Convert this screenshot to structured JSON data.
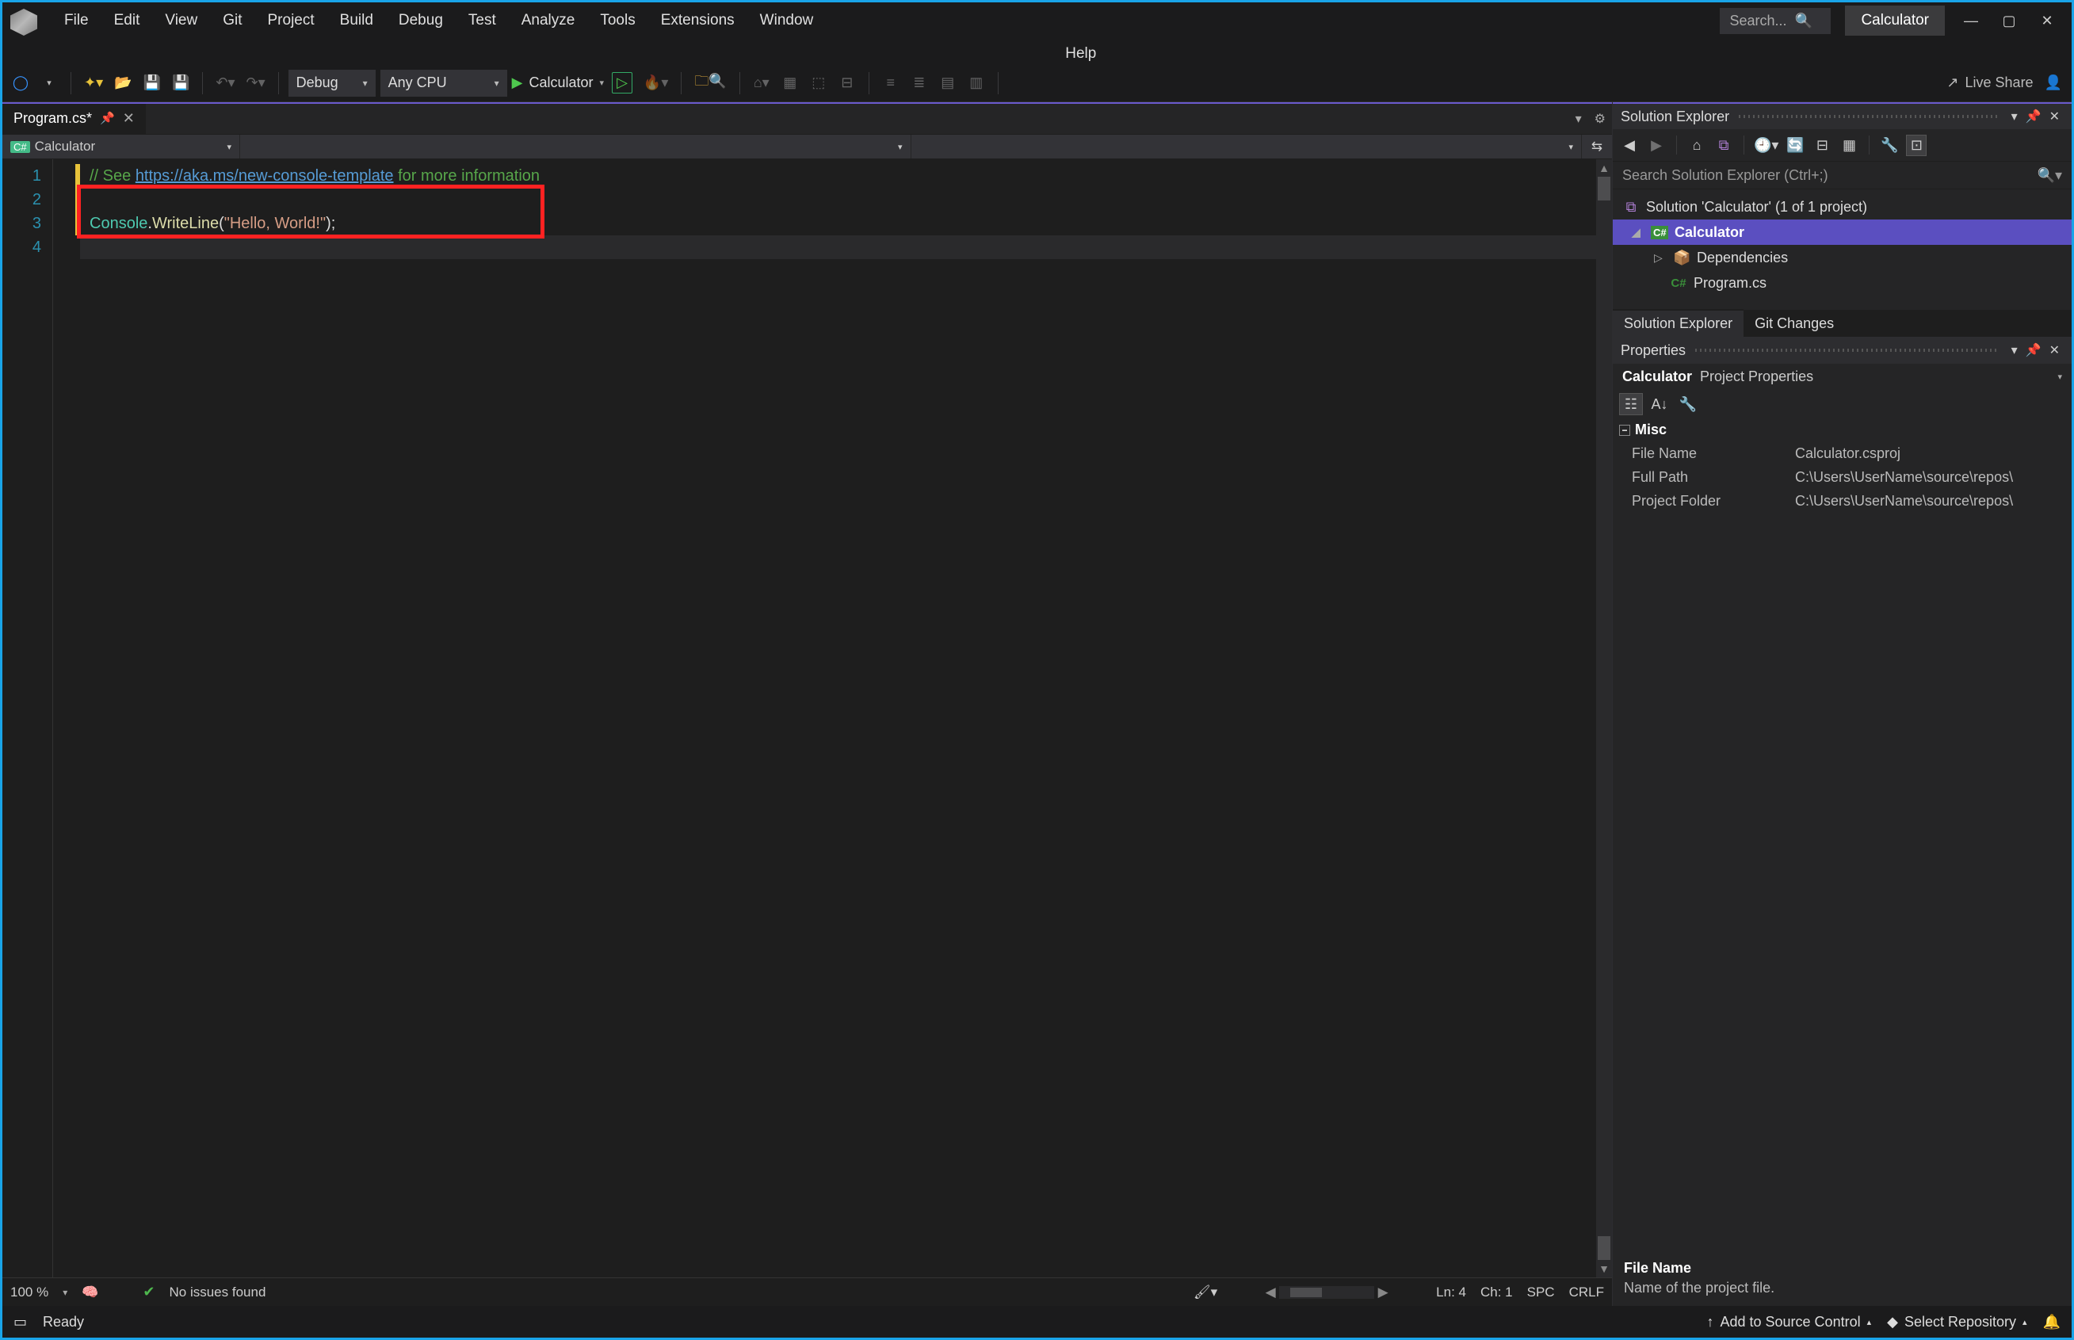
{
  "menus": [
    "File",
    "Edit",
    "View",
    "Git",
    "Project",
    "Build",
    "Debug",
    "Test",
    "Analyze",
    "Tools",
    "Extensions",
    "Window",
    "Help"
  ],
  "search_placeholder": "Search...",
  "app_name": "Calculator",
  "toolbar": {
    "config": "Debug",
    "platform": "Any CPU",
    "start_target": "Calculator",
    "live_share": "Live Share"
  },
  "editor": {
    "tab_name": "Program.cs*",
    "nav_project": "Calculator",
    "code": {
      "comment_prefix": "// See ",
      "comment_link": "https://aka.ms/new-console-template",
      "comment_suffix": " for more information",
      "l3_type": "Console",
      "l3_dot": ".",
      "l3_method": "WriteLine",
      "l3_open": "(",
      "l3_str": "\"Hello, World!\"",
      "l3_close": ");"
    },
    "line_numbers": [
      "1",
      "2",
      "3",
      "4"
    ],
    "status": {
      "zoom": "100 %",
      "issues": "No issues found",
      "ln": "Ln: 4",
      "ch": "Ch: 1",
      "spc": "SPC",
      "crlf": "CRLF"
    }
  },
  "solution": {
    "title": "Solution Explorer",
    "search_placeholder": "Search Solution Explorer (Ctrl+;)",
    "root": "Solution 'Calculator' (1 of 1 project)",
    "project": "Calculator",
    "deps": "Dependencies",
    "file": "Program.cs",
    "tabs": [
      "Solution Explorer",
      "Git Changes"
    ]
  },
  "properties": {
    "title": "Properties",
    "subject_name": "Calculator",
    "subject_type": "Project Properties",
    "group": "Misc",
    "rows": [
      {
        "k": "File Name",
        "v": "Calculator.csproj"
      },
      {
        "k": "Full Path",
        "v": "C:\\Users\\UserName\\source\\repos\\"
      },
      {
        "k": "Project Folder",
        "v": "C:\\Users\\UserName\\source\\repos\\"
      }
    ],
    "desc_title": "File Name",
    "desc_body": "Name of the project file."
  },
  "footer": {
    "ready": "Ready",
    "add_source": "Add to Source Control",
    "select_repo": "Select Repository"
  }
}
